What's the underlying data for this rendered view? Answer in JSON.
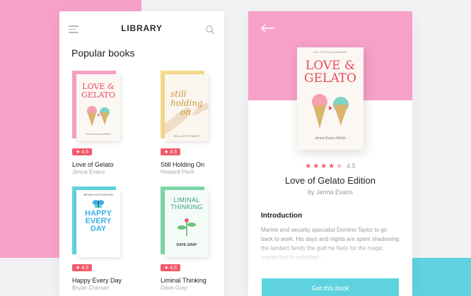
{
  "library": {
    "title": "LIBRARY",
    "section_title": "Popular books",
    "books": [
      {
        "title": "Love of Gelato",
        "author": "Jenna Evans",
        "rating": "4.5",
        "cover_line1": "LOVE &",
        "cover_line2": "GELATO",
        "cover_author": "Jenna Evans Welch",
        "colors": {
          "back": "#f7a1c8",
          "title": "#e84a5a"
        }
      },
      {
        "title": "Still Holding On",
        "author": "Howard Peck",
        "rating": "4.5",
        "cover_line1": "still",
        "cover_line2": "holding",
        "cover_line3": "on",
        "cover_author": "KELL HOFFSTAEDT",
        "colors": {
          "back": "#f6d98a",
          "title": "#c9963b"
        }
      },
      {
        "title": "Happy Every Day",
        "author": "Bryan Chinsan",
        "rating": "4.5",
        "cover_top": "BRYAN HUTCHINSON",
        "cover_line1": "HAPPY",
        "cover_line2": "EVERY",
        "cover_line3": "DAY",
        "colors": {
          "back": "#5ed3df",
          "title": "#3bb1e6"
        }
      },
      {
        "title": "Liminal Thinking",
        "author": "Dave Gray",
        "rating": "4.5",
        "cover_line1": "LIMINAL",
        "cover_line2": "THINKING",
        "cover_author": "DAVE GRAY",
        "colors": {
          "back": "#7ed6a8",
          "title": "#3a9a8a"
        }
      }
    ]
  },
  "detail": {
    "cover_top_text": "New York Times Bestseller",
    "cover_line1": "LOVE &",
    "cover_line2": "GELATO",
    "cover_author": "Jenna Evans Welch",
    "stars": "★★★★",
    "star_off": "★",
    "rating": "4.5",
    "title": "Love of Gelato Edition",
    "author": "by Jenna Evans",
    "intro_heading": "Introduction",
    "intro_text": "Marine and security specialist Domino Taylor to go back to work. His days and nights are spent shadowing the lambert family the guilt he feels for the magic events that in unfolded...",
    "button_label": "Get this book"
  },
  "colors": {
    "pink": "#f7a1c8",
    "cyan": "#5ed3df",
    "badge_red": "#f25a6a"
  }
}
